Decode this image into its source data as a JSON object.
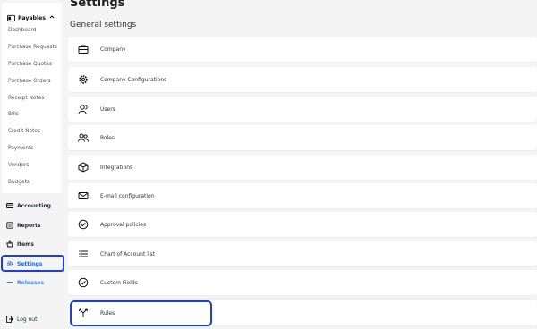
{
  "sidebar": {
    "payables": {
      "label": "Payables",
      "items": [
        {
          "label": "Dashboard"
        },
        {
          "label": "Purchase Requests"
        },
        {
          "label": "Purchase Quotes"
        },
        {
          "label": "Purchase Orders"
        },
        {
          "label": "Receipt Notes"
        },
        {
          "label": "Bills"
        },
        {
          "label": "Credit Notes"
        },
        {
          "label": "Payments"
        },
        {
          "label": "Vendors"
        },
        {
          "label": "Budgets"
        }
      ]
    },
    "main_items": [
      {
        "label": "Accounting",
        "icon": "wallet-icon"
      },
      {
        "label": "Reports",
        "icon": "report-icon"
      },
      {
        "label": "Items",
        "icon": "basket-icon"
      },
      {
        "label": "Settings",
        "icon": "gear-icon",
        "active": true
      },
      {
        "label": "Releases",
        "icon": "releases-icon"
      }
    ],
    "logout_label": "Log out"
  },
  "page": {
    "title": "Settings",
    "section_title": "General settings"
  },
  "settings_rows": [
    {
      "label": "Company",
      "icon": "briefcase-icon"
    },
    {
      "label": "Company Configurations",
      "icon": "gear-icon"
    },
    {
      "label": "Users",
      "icon": "user-icon"
    },
    {
      "label": "Roles",
      "icon": "users-icon"
    },
    {
      "label": "Integrations",
      "icon": "cube-icon"
    },
    {
      "label": "E-mail configuration",
      "icon": "mail-icon"
    },
    {
      "label": "Approval policies",
      "icon": "check-circle-icon"
    },
    {
      "label": "Chart of Account list",
      "icon": "list-icon"
    },
    {
      "label": "Custom Fields",
      "icon": "check-circle-icon"
    },
    {
      "label": "Rules",
      "icon": "split-arrows-icon"
    }
  ],
  "colors": {
    "accent": "#2563eb",
    "highlight_border": "#1d3fd8",
    "background": "#f4f4f5"
  }
}
